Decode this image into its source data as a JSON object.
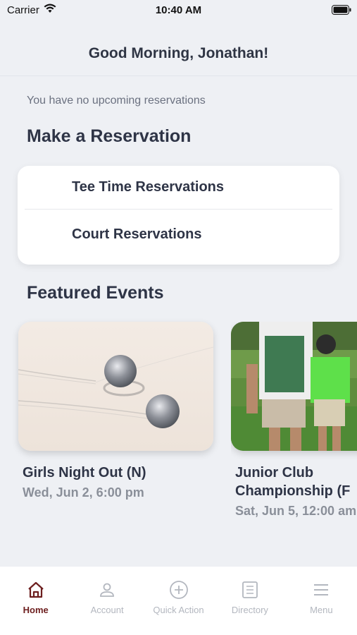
{
  "status_bar": {
    "carrier": "Carrier",
    "time": "10:40 AM"
  },
  "header": {
    "greeting": "Good Morning, Jonathan!"
  },
  "reservations": {
    "empty_message": "You have no upcoming reservations",
    "section_title": "Make a Reservation",
    "items": [
      {
        "label": "Tee Time Reservations"
      },
      {
        "label": "Court Reservations"
      }
    ]
  },
  "events": {
    "section_title": "Featured Events",
    "items": [
      {
        "title": "Girls Night Out (N)",
        "date": "Wed, Jun 2, 6:00 pm"
      },
      {
        "title": "Junior Club Championship (F",
        "date": "Sat, Jun 5, 12:00 am"
      }
    ]
  },
  "tab_bar": {
    "tabs": [
      {
        "label": "Home",
        "icon": "home-icon",
        "active": true
      },
      {
        "label": "Account",
        "icon": "account-icon",
        "active": false
      },
      {
        "label": "Quick Action",
        "icon": "plus-circle-icon",
        "active": false
      },
      {
        "label": "Directory",
        "icon": "directory-icon",
        "active": false
      },
      {
        "label": "Menu",
        "icon": "menu-icon",
        "active": false
      }
    ],
    "active_color": "#6d1f1f",
    "inactive_color": "#b3b7bf"
  }
}
